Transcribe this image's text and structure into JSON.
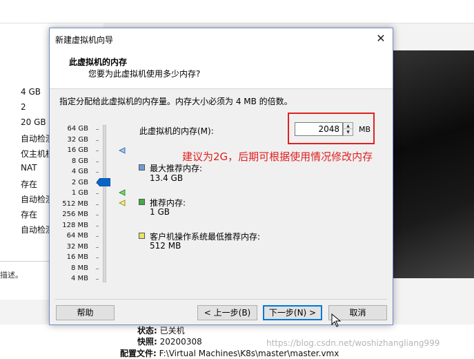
{
  "background": {
    "left_values": [
      "4 GB",
      "2",
      "20 GB",
      "自动检测",
      "仅主机模式",
      "NAT",
      "存在",
      "自动检测",
      "存在",
      "自动检测"
    ],
    "description_text": "描述。",
    "status_label": "状态:",
    "status_value": "已关机",
    "snapshot_label": "快照:",
    "snapshot_value": "20200308",
    "config_label": "配置文件:",
    "config_value": "F:\\Virtual Machines\\K8s\\master\\master.vmx",
    "watermark": "https://blog.csdn.net/woshizhangliang999"
  },
  "dialog": {
    "title": "新建虚拟机向导",
    "close_symbol": "✕",
    "header_title": "此虚拟机的内存",
    "header_subtitle": "您要为此虚拟机使用多少内存?",
    "instruction": "指定分配给此虚拟机的内存量。内存大小必须为 4 MB 的倍数。",
    "memory_label": "此虚拟机的内存(M):",
    "memory_value": "2048",
    "memory_unit": "MB",
    "annotation": "建议为2G，后期可根据使用情况修改内存",
    "scale": [
      "64 GB",
      "32 GB",
      "16 GB",
      "8 GB",
      "4 GB",
      "2 GB",
      "1 GB",
      "512 MB",
      "256 MB",
      "128 MB",
      "64 MB",
      "32 MB",
      "16 MB",
      "8 MB",
      "4 MB"
    ],
    "legend": [
      {
        "title": "最大推荐内存:",
        "value": "13.4 GB",
        "color": "#6f9bd8"
      },
      {
        "title": "推荐内存:",
        "value": "1 GB",
        "color": "#3fae3f"
      },
      {
        "title": "客户机操作系统最低推荐内存:",
        "value": "512 MB",
        "color": "#e8e36a"
      }
    ],
    "buttons": {
      "help": "帮助",
      "back": "< 上一步(B)",
      "next": "下一步(N) >",
      "cancel": "取消"
    }
  },
  "colors": {
    "thumb": "#0a64c8",
    "annotation": "#e02020",
    "highlight_box": "#e02020"
  }
}
